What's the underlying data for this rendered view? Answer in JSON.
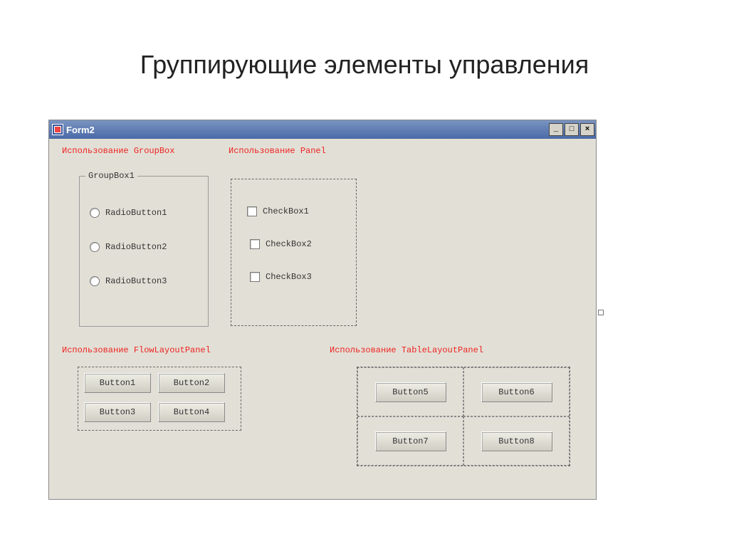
{
  "slideTitle": "Группирующие элементы управления",
  "form": {
    "title": "Form2",
    "sections": {
      "groupbox": "Использование GroupBox",
      "panel": "Использование Panel",
      "flow": "Использование FlowLayoutPanel",
      "table": "Использование TableLayoutPanel"
    },
    "groupboxLegend": "GroupBox1",
    "radios": [
      "RadioButton1",
      "RadioButton2",
      "RadioButton3"
    ],
    "checks": [
      "CheckBox1",
      "CheckBox2",
      "CheckBox3"
    ],
    "flowButtons": [
      "Button1",
      "Button2",
      "Button3",
      "Button4"
    ],
    "tableButtons": [
      "Button5",
      "Button6",
      "Button7",
      "Button8"
    ]
  }
}
